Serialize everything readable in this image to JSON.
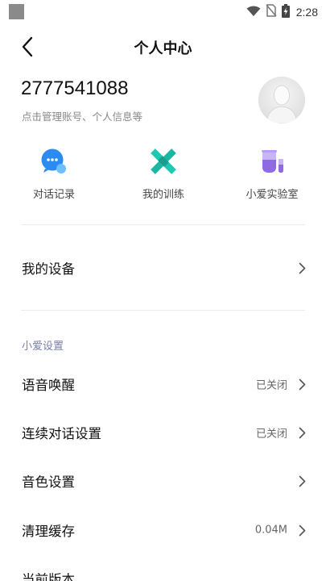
{
  "status_bar": {
    "time": "2:28",
    "icons": [
      "wifi-icon",
      "no-sim-icon",
      "battery-charging-icon"
    ]
  },
  "header": {
    "title": "个人中心",
    "back_icon": "chevron-left-icon"
  },
  "profile": {
    "user_id": "2777541088",
    "subtitle": "点击管理账号、个人信息等",
    "avatar_icon": "default-avatar-icon"
  },
  "quick_actions": [
    {
      "label": "对话记录",
      "icon": "chat-bubble-icon",
      "color": "#2a8cf2"
    },
    {
      "label": "我的训练",
      "icon": "cross-x-icon",
      "color": "#20c5b3"
    },
    {
      "label": "小爱实验室",
      "icon": "test-tube-icon",
      "color": "#9c7be8"
    }
  ],
  "devices_row": {
    "label": "我的设备"
  },
  "section": {
    "title": "小爱设置"
  },
  "settings_rows": [
    {
      "label": "语音唤醒",
      "value": "已关闭"
    },
    {
      "label": "连续对话设置",
      "value": "已关闭"
    },
    {
      "label": "音色设置",
      "value": ""
    },
    {
      "label": "清理缓存",
      "value": "0.04M"
    },
    {
      "label": "当前版本",
      "value": ""
    }
  ],
  "colors": {
    "section_title": "#7a7fa8",
    "divider": "#ececec",
    "text_primary": "#111111",
    "text_secondary": "#888888"
  }
}
